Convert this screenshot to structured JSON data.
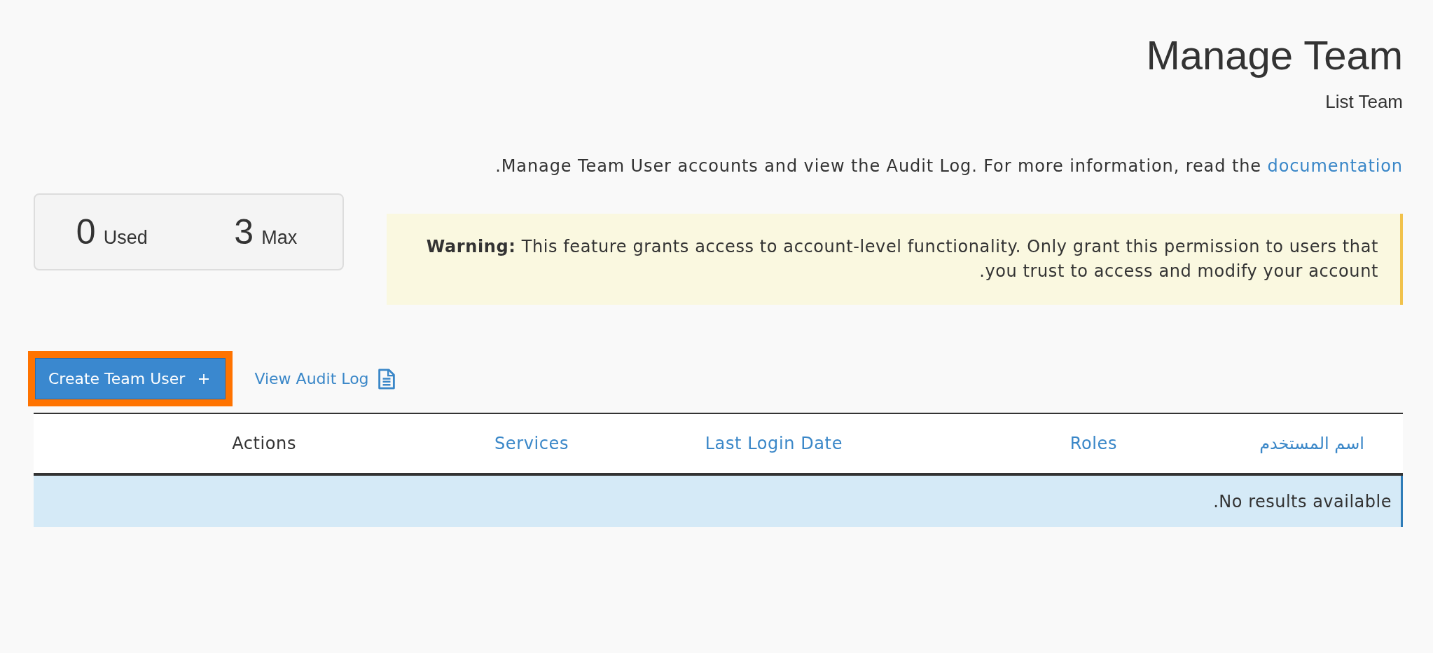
{
  "header": {
    "title": "Manage Team",
    "subtitle": "List Team"
  },
  "intro": {
    "text": ".Manage Team User accounts and view the Audit Log. For more information, read the",
    "link": "documentation"
  },
  "usage": [
    {
      "value": "0",
      "label": "Used"
    },
    {
      "value": "3",
      "label": "Max"
    }
  ],
  "warning": {
    "text": "**Warning:** This feature grants access to account-level functionality. Only grant this permission to users that .you trust to access and modify your account"
  },
  "actions": [
    {
      "kind": "button",
      "label": "Create Team User",
      "highlighted": true
    },
    {
      "kind": "link",
      "label": "View Audit Log"
    }
  ],
  "table": {
    "columns": [
      {
        "label": "Actions",
        "sortable": false
      },
      {
        "label": "Services",
        "sortable": true
      },
      {
        "label": "Last Login Date",
        "sortable": true
      },
      {
        "label": "Roles",
        "sortable": true
      },
      {
        "label": "اسم المستخدم",
        "sortable": true
      }
    ],
    "empty_message": ".No results available"
  }
}
